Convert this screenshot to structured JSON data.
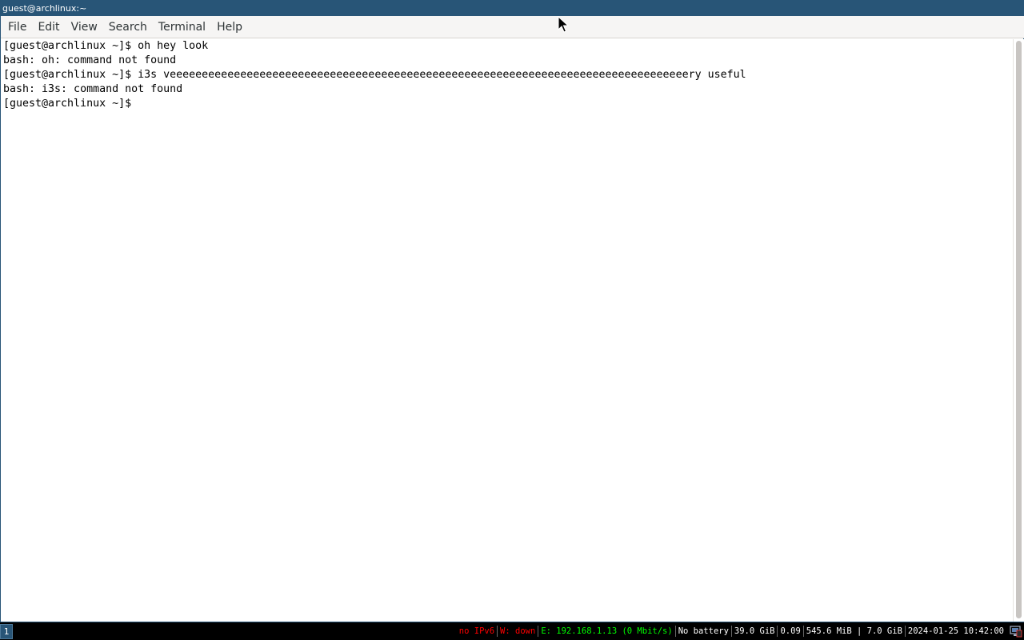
{
  "window": {
    "title": "guest@archlinux:~"
  },
  "menu": {
    "items": [
      "File",
      "Edit",
      "View",
      "Search",
      "Terminal",
      "Help"
    ]
  },
  "terminal": {
    "lines": [
      "[guest@archlinux ~]$ oh hey look",
      "bash: oh: command not found",
      "[guest@archlinux ~]$ i3s veeeeeeeeeeeeeeeeeeeeeeeeeeeeeeeeeeeeeeeeeeeeeeeeeeeeeeeeeeeeeeeeeeeeeeeeeeeeeeeeery useful",
      "bash: i3s: command not found",
      "[guest@archlinux ~]$"
    ]
  },
  "taskbar": {
    "workspace": "1",
    "status": [
      {
        "text": "no IPv6",
        "color": "#ff0000"
      },
      {
        "text": "W: down",
        "color": "#ff0000"
      },
      {
        "text": "E: 192.168.1.13 (0 Mbit/s)",
        "color": "#00ff00"
      },
      {
        "text": "No battery",
        "color": "#ffffff"
      },
      {
        "text": "39.0 GiB",
        "color": "#ffffff"
      },
      {
        "text": "0.09",
        "color": "#ffffff"
      },
      {
        "text": "545.6 MiB | 7.0 GiB",
        "color": "#ffffff"
      },
      {
        "text": "2024-01-25 10:42:00",
        "color": "#ffffff"
      }
    ],
    "tray_icon": "network-manager-icon"
  },
  "colors": {
    "title_bg": "#285577",
    "menu_bg": "#f6f5f4",
    "terminal_bg": "#ffffff",
    "bar_bg": "#000000"
  }
}
